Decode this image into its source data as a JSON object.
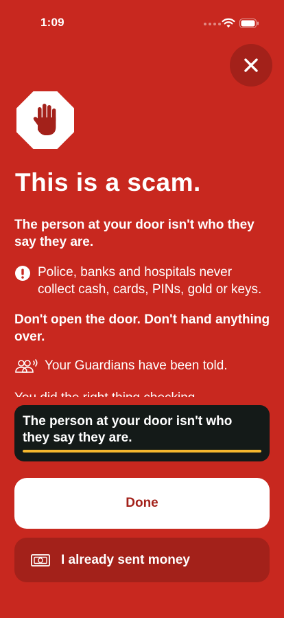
{
  "status_bar": {
    "time": "1:09"
  },
  "close_button": {
    "icon": "close-icon"
  },
  "alert": {
    "icon": "stop-hand-icon",
    "title": "This is a scam.",
    "lead": "The person at your door isn't who they say they are.",
    "info": "Police, banks and hospitals never collect cash, cards, PINs, gold or keys.",
    "action": "Don't open the door. Don't hand anything over.",
    "guardians": "Your Guardians have been told.",
    "clipped_line": "You did the right thing checking."
  },
  "caption": {
    "text": "The person at your door isn't who they say they are.",
    "progress": 1.0
  },
  "buttons": {
    "done": "Done",
    "sent_money": "I already sent money"
  },
  "colors": {
    "background": "#C8281F",
    "dark_red": "#A3211A",
    "caption_bg": "#141A18",
    "progress": "#F5B82E"
  }
}
